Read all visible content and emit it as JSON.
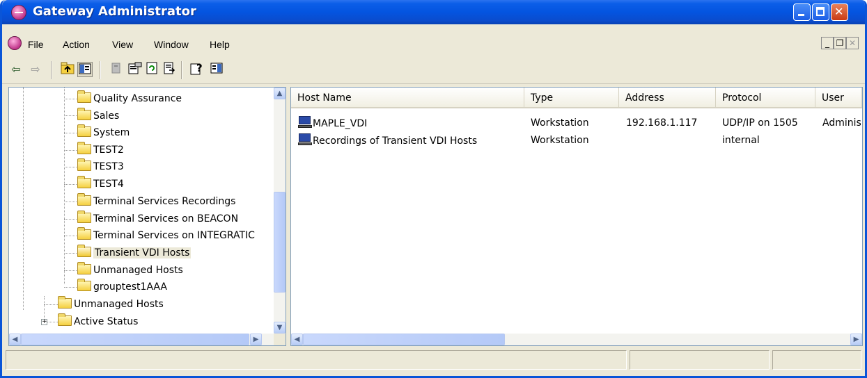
{
  "window": {
    "title": "Gateway Administrator",
    "controls": {
      "minimize": "minimize",
      "maximize": "maximize",
      "close": "close"
    }
  },
  "menu": {
    "items": [
      "File",
      "Action",
      "View",
      "Window",
      "Help"
    ]
  },
  "toolbar": {
    "buttons": [
      "back-arrow-icon",
      "forward-arrow-icon",
      "up-one-level-icon",
      "show-hide-console-tree-icon",
      "delete-icon",
      "properties-icon",
      "refresh-icon",
      "export-list-icon",
      "help-icon",
      "show-hide-action-pane-icon"
    ]
  },
  "tree": {
    "items": [
      {
        "label": "Quality Assurance",
        "level": 2
      },
      {
        "label": "Sales",
        "level": 2
      },
      {
        "label": "System",
        "level": 2
      },
      {
        "label": "TEST2",
        "level": 2
      },
      {
        "label": "TEST3",
        "level": 2
      },
      {
        "label": "TEST4",
        "level": 2
      },
      {
        "label": "Terminal Services Recordings",
        "level": 2
      },
      {
        "label": "Terminal Services on BEACON",
        "level": 2
      },
      {
        "label": "Terminal Services on INTEGRATIC",
        "level": 2
      },
      {
        "label": "Transient VDI Hosts",
        "level": 2,
        "selected": true
      },
      {
        "label": "Unmanaged Hosts",
        "level": 2
      },
      {
        "label": "grouptest1AAA",
        "level": 2
      },
      {
        "label": "Unmanaged Hosts",
        "level": 1
      },
      {
        "label": "Active Status",
        "level": 1,
        "expandable": true
      }
    ]
  },
  "list": {
    "columns": [
      "Host Name",
      "Type",
      "Address",
      "Protocol",
      "User"
    ],
    "rows": [
      {
        "host": "MAPLE_VDI",
        "type": "Workstation",
        "address": "192.168.1.117",
        "protocol": "UDP/IP on 1505",
        "user": "Administ"
      },
      {
        "host": "Recordings of Transient VDI Hosts",
        "type": "Workstation",
        "address": "",
        "protocol": "internal",
        "user": ""
      }
    ]
  },
  "statusbar": {
    "panels": [
      "",
      "",
      ""
    ]
  },
  "colors": {
    "title_bar": "#0454e0",
    "window_face": "#ece9d8",
    "scroll_thumb": "#c1d3fb"
  }
}
